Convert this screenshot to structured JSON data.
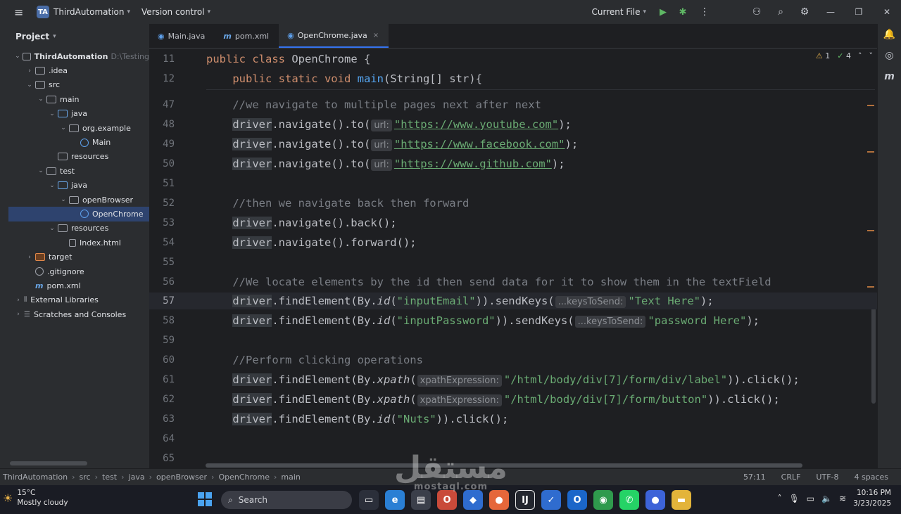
{
  "titlebar": {
    "badge": "TA",
    "project": "ThirdAutomation",
    "vcs": "Version control",
    "run_config": "Current File"
  },
  "project_panel": {
    "title": "Project",
    "tree": [
      {
        "label": "ThirdAutomation",
        "hint": "D:\\Testing",
        "depth": 0,
        "icon": "folder",
        "expanded": true,
        "bold": true
      },
      {
        "label": ".idea",
        "depth": 1,
        "icon": "folder",
        "expanded": false
      },
      {
        "label": "src",
        "depth": 1,
        "icon": "folder",
        "expanded": true
      },
      {
        "label": "main",
        "depth": 2,
        "icon": "folder",
        "expanded": true
      },
      {
        "label": "java",
        "depth": 3,
        "icon": "src-folder",
        "expanded": true
      },
      {
        "label": "org.example",
        "depth": 4,
        "icon": "package",
        "expanded": true
      },
      {
        "label": "Main",
        "depth": 5,
        "icon": "class",
        "leaf": true
      },
      {
        "label": "resources",
        "depth": 3,
        "icon": "folder",
        "leaf": true
      },
      {
        "label": "test",
        "depth": 2,
        "icon": "folder",
        "expanded": true
      },
      {
        "label": "java",
        "depth": 3,
        "icon": "src-folder",
        "expanded": true
      },
      {
        "label": "openBrowser",
        "depth": 4,
        "icon": "package",
        "expanded": true
      },
      {
        "label": "OpenChrome",
        "depth": 5,
        "icon": "class",
        "leaf": true,
        "selected": true
      },
      {
        "label": "resources",
        "depth": 3,
        "icon": "folder",
        "expanded": true
      },
      {
        "label": "Index.html",
        "depth": 4,
        "icon": "file",
        "leaf": true
      },
      {
        "label": "target",
        "depth": 1,
        "icon": "orange-folder",
        "expanded": false
      },
      {
        "label": ".gitignore",
        "depth": 1,
        "icon": "git",
        "leaf": true
      },
      {
        "label": "pom.xml",
        "depth": 1,
        "icon": "maven",
        "leaf": true
      },
      {
        "label": "External Libraries",
        "depth": 0,
        "icon": "bars",
        "expanded": false
      },
      {
        "label": "Scratches and Consoles",
        "depth": 0,
        "icon": "console",
        "expanded": false
      }
    ]
  },
  "tabs": [
    {
      "label": "Main.java",
      "icon": "class-icon"
    },
    {
      "label": "pom.xml",
      "icon": "maven-icon"
    },
    {
      "label": "OpenChrome.java",
      "icon": "class-icon",
      "active": true,
      "close": "×"
    }
  ],
  "inspections": {
    "warnings": "1",
    "checks": "4"
  },
  "code": [
    {
      "n": "11",
      "sticky": true,
      "tokens": [
        [
          "kw",
          "public class "
        ],
        [
          "plain",
          "OpenChrome {"
        ]
      ]
    },
    {
      "n": "12",
      "sticky": true,
      "tokens": [
        [
          "plain",
          "    "
        ],
        [
          "kw",
          "public static void "
        ],
        [
          "fn",
          "main"
        ],
        [
          "plain",
          "(String[] str){"
        ]
      ]
    },
    {
      "n": "47",
      "tokens": [
        [
          "cmt",
          "    //we navigate to multiple pages next after next"
        ]
      ]
    },
    {
      "n": "48",
      "tokens": [
        [
          "plain",
          "    "
        ],
        [
          "drv",
          "driver"
        ],
        [
          "plain",
          ".navigate().to("
        ],
        [
          "hint",
          "url:"
        ],
        [
          "strlink",
          "\"https://www.youtube.com\""
        ],
        [
          "plain",
          ");"
        ]
      ]
    },
    {
      "n": "49",
      "tokens": [
        [
          "plain",
          "    "
        ],
        [
          "drv",
          "driver"
        ],
        [
          "plain",
          ".navigate().to("
        ],
        [
          "hint",
          "url:"
        ],
        [
          "strlink",
          "\"https://www.facebook.com\""
        ],
        [
          "plain",
          ");"
        ]
      ]
    },
    {
      "n": "50",
      "tokens": [
        [
          "plain",
          "    "
        ],
        [
          "drv",
          "driver"
        ],
        [
          "plain",
          ".navigate().to("
        ],
        [
          "hint",
          "url:"
        ],
        [
          "strlink",
          "\"https://www.github.com\""
        ],
        [
          "plain",
          ");"
        ]
      ]
    },
    {
      "n": "51",
      "tokens": []
    },
    {
      "n": "52",
      "tokens": [
        [
          "cmt",
          "    //then we navigate back then forward"
        ]
      ]
    },
    {
      "n": "53",
      "tokens": [
        [
          "plain",
          "    "
        ],
        [
          "drv",
          "driver"
        ],
        [
          "plain",
          ".navigate().back();"
        ]
      ]
    },
    {
      "n": "54",
      "tokens": [
        [
          "plain",
          "    "
        ],
        [
          "drv",
          "driver"
        ],
        [
          "plain",
          ".navigate().forward();"
        ]
      ]
    },
    {
      "n": "55",
      "tokens": []
    },
    {
      "n": "56",
      "tokens": [
        [
          "cmt",
          "    //We locate elements by the id then send data for it to show them in the textField"
        ]
      ]
    },
    {
      "n": "57",
      "current": true,
      "tokens": [
        [
          "plain",
          "    "
        ],
        [
          "drv",
          "driver"
        ],
        [
          "plain",
          ".findElement(By."
        ],
        [
          "it",
          "id"
        ],
        [
          "plain",
          "("
        ],
        [
          "str",
          "\"inputEmail\""
        ],
        [
          "plain",
          ")).sendKeys("
        ],
        [
          "hint",
          "...keysToSend:"
        ],
        [
          "str",
          "\"Text Here\""
        ],
        [
          "plain",
          ");"
        ]
      ]
    },
    {
      "n": "58",
      "tokens": [
        [
          "plain",
          "    "
        ],
        [
          "drv",
          "driver"
        ],
        [
          "plain",
          ".findElement(By."
        ],
        [
          "it",
          "id"
        ],
        [
          "plain",
          "("
        ],
        [
          "str",
          "\"inputPassword\""
        ],
        [
          "plain",
          ")).sendKeys("
        ],
        [
          "hint",
          "...keysToSend:"
        ],
        [
          "str",
          "\"password Here\""
        ],
        [
          "plain",
          ");"
        ]
      ]
    },
    {
      "n": "59",
      "tokens": []
    },
    {
      "n": "60",
      "tokens": [
        [
          "cmt",
          "    //Perform clicking operations"
        ]
      ]
    },
    {
      "n": "61",
      "tokens": [
        [
          "plain",
          "    "
        ],
        [
          "drv",
          "driver"
        ],
        [
          "plain",
          ".findElement(By."
        ],
        [
          "it",
          "xpath"
        ],
        [
          "plain",
          "("
        ],
        [
          "hint",
          "xpathExpression:"
        ],
        [
          "str",
          "\"/html/body/div[7]/form/div/label\""
        ],
        [
          "plain",
          ")).click();"
        ]
      ]
    },
    {
      "n": "62",
      "tokens": [
        [
          "plain",
          "    "
        ],
        [
          "drv",
          "driver"
        ],
        [
          "plain",
          ".findElement(By."
        ],
        [
          "it",
          "xpath"
        ],
        [
          "plain",
          "("
        ],
        [
          "hint",
          "xpathExpression:"
        ],
        [
          "str",
          "\"/html/body/div[7]/form/button\""
        ],
        [
          "plain",
          ")).click();"
        ]
      ]
    },
    {
      "n": "63",
      "tokens": [
        [
          "plain",
          "    "
        ],
        [
          "drv",
          "driver"
        ],
        [
          "plain",
          ".findElement(By."
        ],
        [
          "it",
          "id"
        ],
        [
          "plain",
          "("
        ],
        [
          "str",
          "\"Nuts\""
        ],
        [
          "plain",
          ")).click();"
        ]
      ]
    },
    {
      "n": "64",
      "tokens": []
    },
    {
      "n": "65",
      "tokens": []
    }
  ],
  "statusbar": {
    "crumbs": [
      "ThirdAutomation",
      "src",
      "test",
      "java",
      "openBrowser",
      "OpenChrome",
      "main"
    ],
    "position": "57:11",
    "line_sep": "CRLF",
    "encoding": "UTF-8",
    "indent": "4 spaces"
  },
  "taskbar": {
    "temp": "15°C",
    "weather": "Mostly cloudy",
    "search_placeholder": "Search",
    "time": "10:16 PM",
    "date": "3/23/2025"
  },
  "watermark": {
    "text": "مستقل",
    "sub": "mostaql.com"
  }
}
